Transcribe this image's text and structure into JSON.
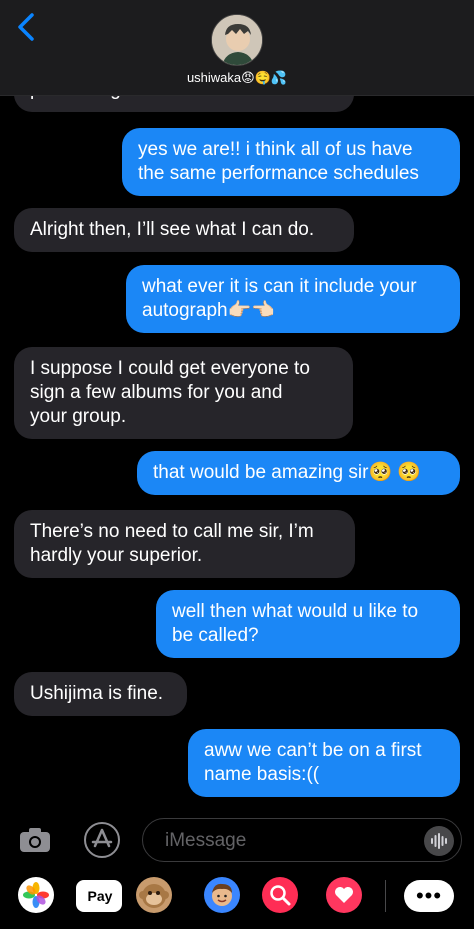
{
  "header": {
    "contact_name": "ushiwaka😡🤤💦"
  },
  "messages": [
    {
      "direction": "in",
      "text": "performing on one tomorrow?"
    },
    {
      "direction": "out",
      "text": "yes we are!! i think all of us have\nthe same performance schedules"
    },
    {
      "direction": "in",
      "text": "Alright then, I’ll see what I can do."
    },
    {
      "direction": "out",
      "text": "what ever it is can it include your\nautograph👉🏻👈🏻"
    },
    {
      "direction": "in",
      "text": "I suppose I could get everyone to\nsign a few albums for you and\nyour group."
    },
    {
      "direction": "out",
      "text": "that would be amazing sir🥺 🥺"
    },
    {
      "direction": "in",
      "text": "There’s no need to call me sir, I’m\nhardly your superior."
    },
    {
      "direction": "out",
      "text": "well then what would u like to\nbe called?"
    },
    {
      "direction": "in",
      "text": "Ushijima is fine."
    },
    {
      "direction": "out",
      "text": "aww we can’t be on a first\nname basis:(("
    }
  ],
  "input": {
    "placeholder": "iMessage"
  },
  "app_drawer": {
    "applepay_label": "Pay",
    "more_label": "•••"
  },
  "colors": {
    "outgoing_bubble": "#1b87f6",
    "incoming_bubble": "#26252a",
    "background": "#000000"
  }
}
